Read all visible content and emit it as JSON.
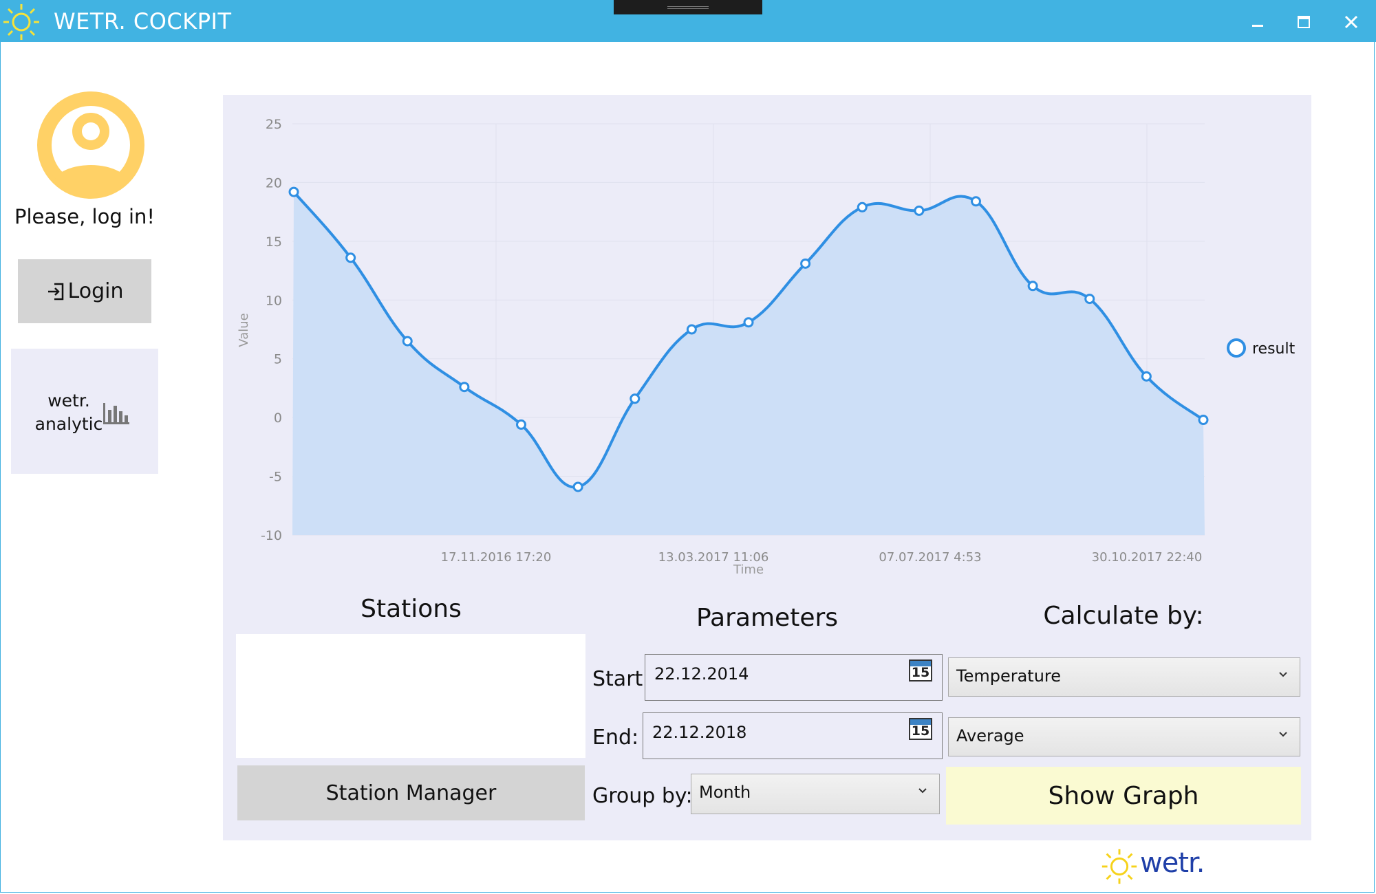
{
  "window": {
    "title": "WETR. COCKPIT",
    "accent_color": "#41b3e2",
    "controls": [
      "minimize-icon",
      "maximize-icon",
      "close-icon"
    ]
  },
  "sidebar": {
    "avatar_icon": "user-circle-icon",
    "avatar_color": "#ffd166",
    "login_prompt": "Please, log in!",
    "login_button_label": "Login",
    "login_icon": "sign-in-icon",
    "analytic_label_line1": "wetr.",
    "analytic_label_line2": "analytic",
    "analytic_icon": "bar-chart-icon"
  },
  "chart_data": {
    "type": "area",
    "xlabel": "Time",
    "ylabel": "Value",
    "ylim": [
      -10,
      25
    ],
    "yticks": [
      25,
      20,
      15,
      10,
      5,
      0,
      -5,
      -10
    ],
    "x_ticks": [
      "17.11.2016 17:20",
      "13.03.2017 11:06",
      "07.07.2017 4:53",
      "30.10.2017 22:40"
    ],
    "grid": true,
    "legend_position": "right",
    "line_color": "#2f8fe3",
    "fill_color": "#cddff7",
    "series": [
      {
        "name": "result",
        "values": [
          19.2,
          13.6,
          6.5,
          2.6,
          -0.6,
          -5.9,
          1.6,
          7.5,
          8.1,
          13.1,
          17.9,
          17.6,
          18.4,
          11.2,
          10.1,
          3.5,
          -0.2
        ]
      }
    ]
  },
  "stations": {
    "title": "Stations",
    "manager_button_label": "Station Manager"
  },
  "parameters": {
    "title": "Parameters",
    "start_label": "Start:",
    "start_value": "22.12.2014",
    "end_label": "End:",
    "end_value": "22.12.2018",
    "calendar_day": "15",
    "group_by_label": "Group by:",
    "group_by_value": "Month"
  },
  "calculate": {
    "title": "Calculate by:",
    "parameter_value": "Temperature",
    "calculation_value": "Average",
    "show_graph_label": "Show Graph",
    "show_graph_color": "#fafad2"
  },
  "brand": {
    "logo_text": "wetr.",
    "logo_icon": "sun-icon"
  }
}
